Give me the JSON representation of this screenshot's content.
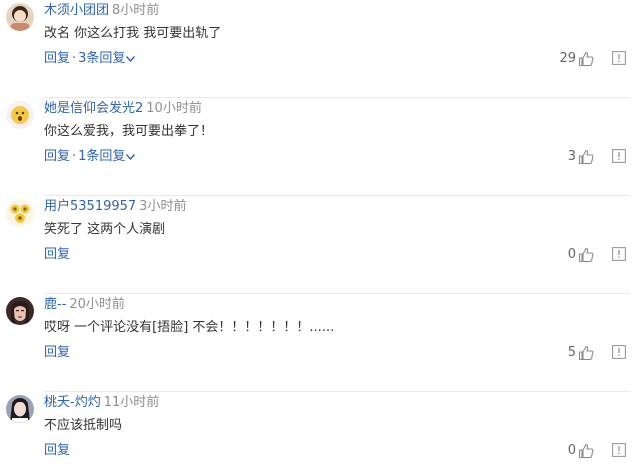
{
  "comments": [
    {
      "username": "木须小团团",
      "time": "8小时前",
      "text": "改名 你这么打我 我可要出轨了",
      "reply_label": "回复",
      "replies_label": "3条回复",
      "like_count": "29"
    },
    {
      "username": "她是信仰会发光2",
      "time": "10小时前",
      "text": "你这么爱我，我可要出拳了！",
      "reply_label": "回复",
      "replies_label": "1条回复",
      "like_count": "3"
    },
    {
      "username": "用户53519957",
      "time": "3小时前",
      "text": "笑死了 这两个人演剧",
      "reply_label": "回复",
      "like_count": "0"
    },
    {
      "username": "鹿--",
      "time": "20小时前",
      "text": "哎呀 一个评论没有[捂脸] 不会！！！！！！！......",
      "reply_label": "回复",
      "like_count": "5"
    },
    {
      "username": "桃夭-灼灼",
      "time": "11小时前",
      "text": "不应该抵制吗",
      "reply_label": "回复",
      "like_count": "0"
    }
  ],
  "colors": {
    "link": "#2d64b3",
    "time": "#8f8f8f",
    "text": "#333333",
    "divider": "#e9e9e9"
  },
  "icons": {
    "like": "thumbs-up-icon",
    "report": "report-icon",
    "expand": "chevron-down-icon"
  }
}
